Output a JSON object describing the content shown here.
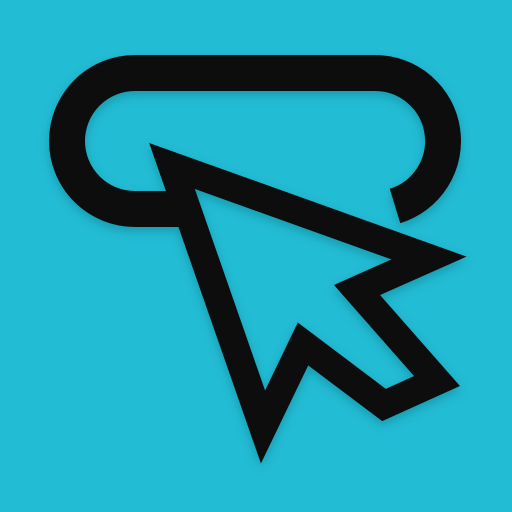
{
  "icon": {
    "name": "button-click-icon",
    "colors": {
      "background": "#22BCD4",
      "stroke": "#111111",
      "shadow": "#0a5c68"
    }
  }
}
